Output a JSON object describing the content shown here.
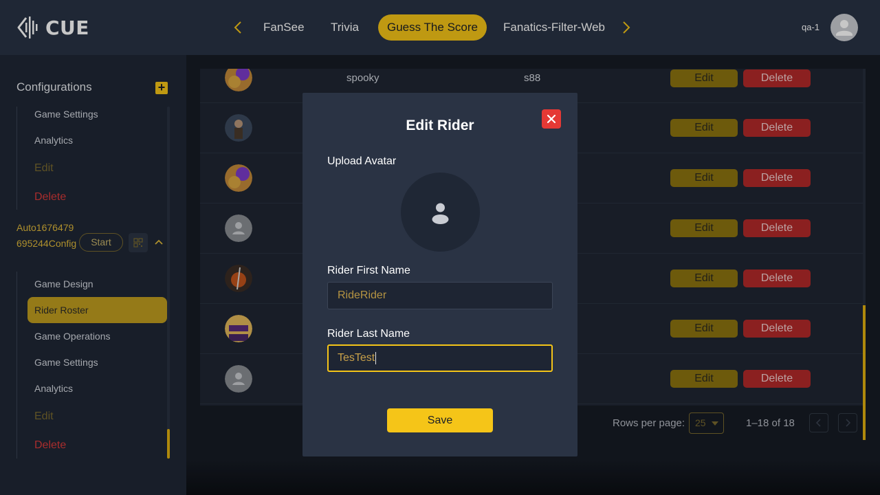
{
  "header": {
    "logo_text": "CUE",
    "tabs": [
      {
        "label": "FanSee"
      },
      {
        "label": "Trivia"
      },
      {
        "label": "Guess The Score"
      },
      {
        "label": "Fanatics-Filter-Web"
      }
    ],
    "active_tab": "Guess The Score",
    "username": "qa-1"
  },
  "sidebar": {
    "title": "Configurations",
    "group1": {
      "items": [
        "Game Settings",
        "Analytics"
      ],
      "edit_label": "Edit",
      "delete_label": "Delete"
    },
    "config": {
      "name": "Auto1676479695244Config",
      "start_label": "Start"
    },
    "group2": {
      "items": [
        "Game Design",
        "Rider Roster",
        "Game Operations",
        "Game Settings",
        "Analytics"
      ],
      "active_item": "Rider Roster",
      "edit_label": "Edit",
      "delete_label": "Delete"
    }
  },
  "table": {
    "rows": [
      {
        "first": "spooky",
        "last": "s88",
        "avatar": "paint-swirl"
      },
      {
        "first": "",
        "last": "",
        "avatar": "warrior"
      },
      {
        "first": "",
        "last": "",
        "avatar": "paint-swirl"
      },
      {
        "first": "",
        "last": "",
        "avatar": "default-person"
      },
      {
        "first": "",
        "last": "",
        "avatar": "pumpkin-knife"
      },
      {
        "first": "",
        "last": "",
        "avatar": "happy-halloween"
      },
      {
        "first": "",
        "last": "",
        "avatar": "default-person"
      }
    ],
    "edit_label": "Edit",
    "delete_label": "Delete",
    "pagination": {
      "rows_per_page_label": "Rows per page:",
      "rows_per_page_value": "25",
      "range": "1–18 of 18"
    }
  },
  "modal": {
    "title": "Edit Rider",
    "upload_label": "Upload Avatar",
    "first_name_label": "Rider First Name",
    "first_name_value": "RideRider",
    "last_name_label": "Rider Last Name",
    "last_name_value": "TesTest",
    "save_label": "Save"
  },
  "colors": {
    "accent": "#f5c518",
    "danger": "#e53935",
    "header_bg": "#283244",
    "modal_bg": "#2a3344"
  }
}
